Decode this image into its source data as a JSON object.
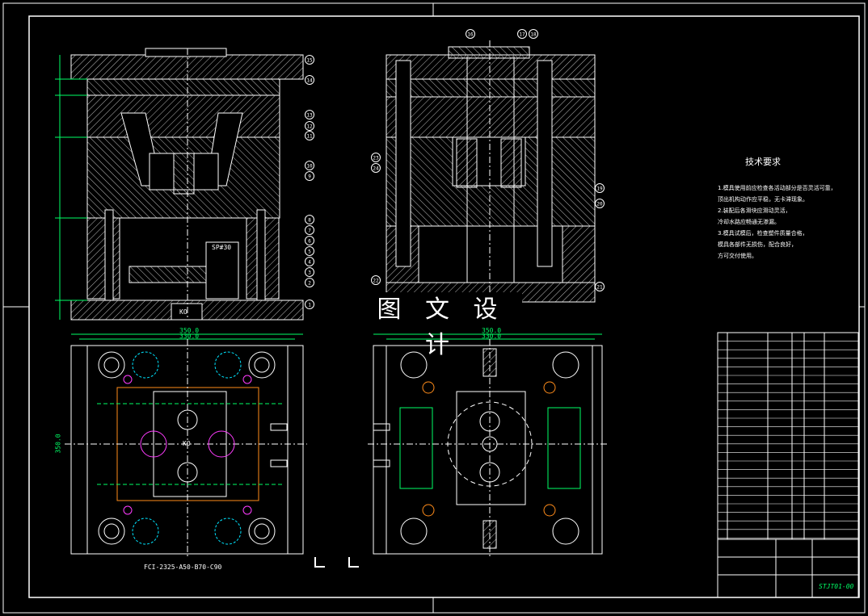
{
  "drawing": {
    "watermark": "图 文 设 计",
    "caption": "FCI-2325-A50-B70-C90",
    "side_label_sp": "SP#30",
    "block_label": "KO",
    "center_label": "KO",
    "drawing_number": "STJT01-00",
    "tech_requirements": {
      "title": "技术要求",
      "lines": [
        "1.模具使用前应检查各活动部分是否灵活可靠，",
        "顶出机构动作应平稳，无卡滞现象。",
        "2.装配后各滑块应滑动灵活，",
        "冷却水路应畅通无渗漏。",
        "3.模具试模后，检查塑件质量合格，",
        "模具各部件无损伤，配合良好，",
        "方可交付使用。"
      ]
    },
    "balloons_left": [
      "15",
      "14",
      "13",
      "12",
      "11",
      "10",
      "9",
      "8",
      "7",
      "6",
      "5",
      "4",
      "3",
      "2",
      "1"
    ],
    "balloons_right": [
      "16",
      "17",
      "18",
      "19",
      "20",
      "21",
      "22",
      "23",
      "24"
    ],
    "dimensions_top": [
      "350.0",
      "330.0"
    ],
    "dimensions_right_top": [
      "350.0",
      "330.0"
    ],
    "dimension_vertical": "350.0",
    "colors": {
      "hatch": "#ffffff",
      "line": "#ffffff",
      "accent_green": "#00ff66",
      "accent_magenta": "#ff3cff",
      "accent_cyan": "#00e5ff",
      "accent_orange": "#ff8c1a"
    }
  }
}
